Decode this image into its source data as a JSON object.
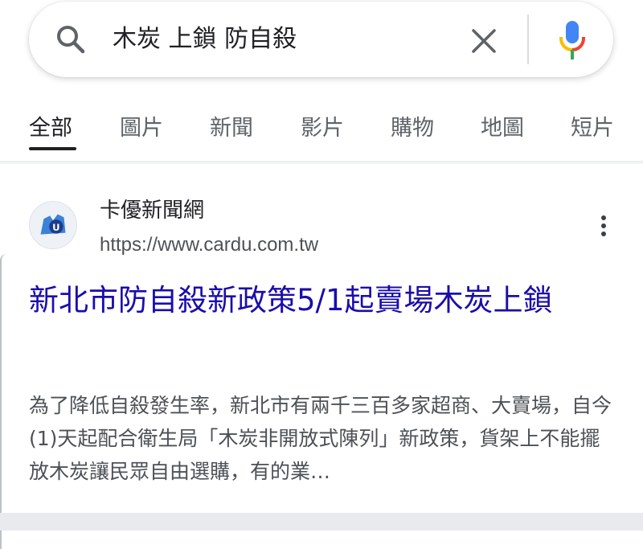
{
  "search": {
    "query": "木炭 上鎖 防自殺"
  },
  "tabs": [
    {
      "label": "全部"
    },
    {
      "label": "圖片"
    },
    {
      "label": "新聞"
    },
    {
      "label": "影片"
    },
    {
      "label": "購物"
    },
    {
      "label": "地圖"
    },
    {
      "label": "短片"
    }
  ],
  "result": {
    "site_name": "卡優新聞網",
    "url": "https://www.cardu.com.tw",
    "title": "新北市防自殺新政策5/1起賣場木炭上鎖",
    "snippet": "為了降低自殺發生率，新北市有兩千三百多家超商、大賣場，自今(1)天起配合衛生局「木炭非開放式陳列」新政策，貨架上不能擺放木炭讓民眾自由選購，有的業…"
  },
  "icons": {
    "search": "search-icon",
    "clear": "close-icon",
    "mic": "microphone-icon",
    "more": "more-vert-icon",
    "favicon": "site-favicon"
  },
  "colors": {
    "link": "#1a0dab",
    "text": "#202124",
    "secondary": "#5f6368"
  }
}
